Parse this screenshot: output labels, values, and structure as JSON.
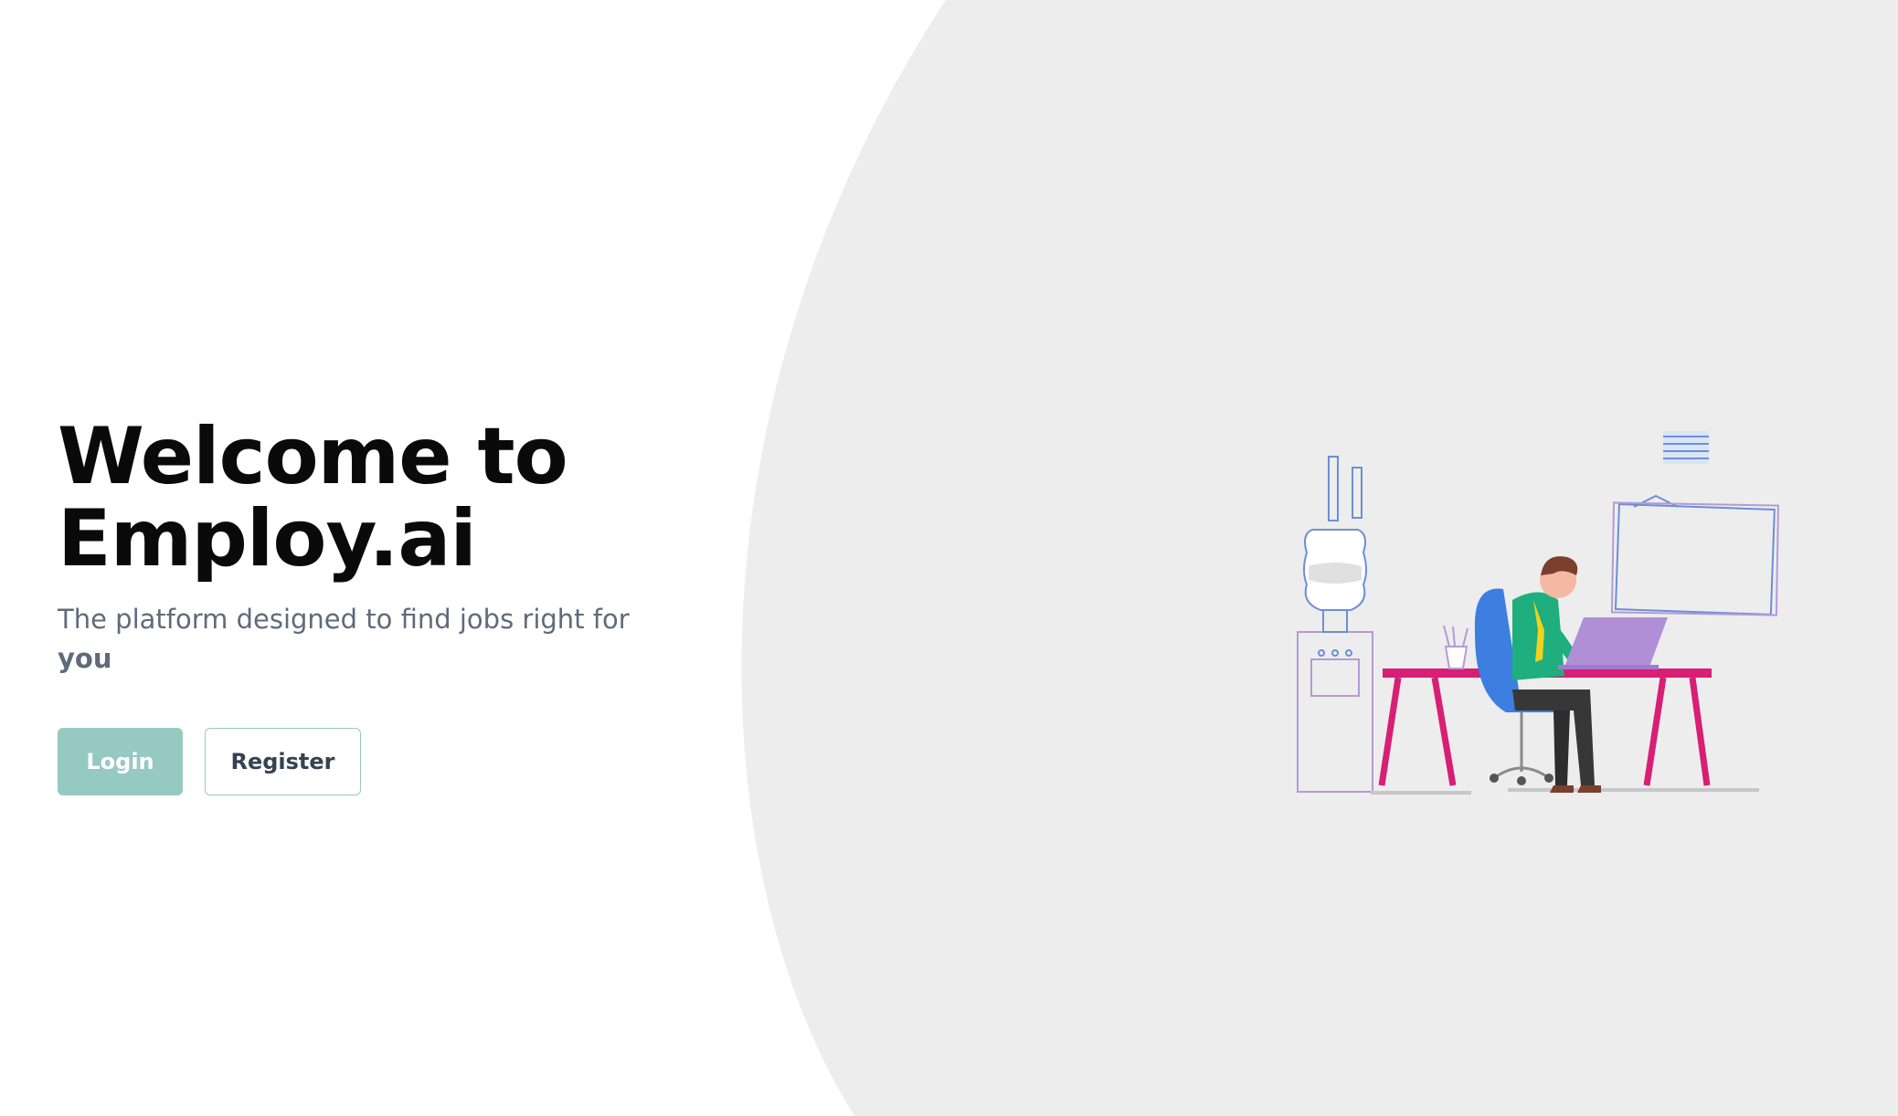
{
  "hero": {
    "title_line1": "Welcome to",
    "title_line2": "Employ.ai",
    "subtitle_main": "The platform designed to find jobs right for",
    "subtitle_emphasis": "you"
  },
  "actions": {
    "login_label": "Login",
    "register_label": "Register"
  },
  "colors": {
    "background": "#ffffff",
    "panel": "#ededed",
    "accent": "#97c9c3",
    "title": "#0a0a0a",
    "subtitle": "#5f6b7a"
  },
  "illustration": {
    "description_icon": "office-worker-illustration"
  }
}
